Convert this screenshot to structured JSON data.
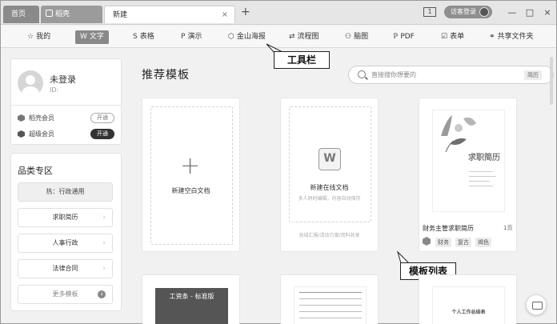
{
  "titlebar": {
    "tabs": [
      {
        "label": "首页"
      },
      {
        "label": "稻壳"
      },
      {
        "label": "新建"
      }
    ],
    "new_tab_symbol": "+",
    "close_symbol": "×",
    "badge_number": "1",
    "login_label": "访客登录",
    "win_min": "—",
    "win_max": "□",
    "win_close": "×"
  },
  "toolbar": {
    "items": [
      {
        "label": "我的",
        "icon": "star-icon",
        "glyph": "☆"
      },
      {
        "label": "文字",
        "icon": "w-icon",
        "glyph": "W"
      },
      {
        "label": "表格",
        "icon": "s-icon",
        "glyph": "S"
      },
      {
        "label": "演示",
        "icon": "p-icon",
        "glyph": "P"
      },
      {
        "label": "金山海报",
        "icon": "poster-icon",
        "glyph": "⬡"
      },
      {
        "label": "流程图",
        "icon": "flowchart-icon",
        "glyph": "⇄"
      },
      {
        "label": "脑图",
        "icon": "mindmap-icon",
        "glyph": "⚇"
      },
      {
        "label": "PDF",
        "icon": "pdf-icon",
        "glyph": "ℙ"
      },
      {
        "label": "表单",
        "icon": "form-icon",
        "glyph": "☑"
      },
      {
        "label": "共享文件夹",
        "icon": "shared-folder-icon",
        "glyph": "⚭"
      }
    ]
  },
  "callouts": {
    "toolbar": "工具栏",
    "template_list": "模板列表"
  },
  "user": {
    "name": "未登录",
    "id": "ID:",
    "memberships": [
      {
        "label": "稻壳会员",
        "action": "开通"
      },
      {
        "label": "超级会员",
        "action": "开通"
      }
    ]
  },
  "categories": {
    "title": "品类专区",
    "items": [
      {
        "label": "热：行政通用"
      },
      {
        "label": "求职简历"
      },
      {
        "label": "人事行政"
      },
      {
        "label": "法律合同"
      },
      {
        "label": "更多模板"
      }
    ]
  },
  "main": {
    "title": "推荐模板",
    "search": {
      "placeholder": "直接搜你想要的",
      "tag": "简历"
    },
    "blank_doc": {
      "label": "新建空白文档"
    },
    "online_doc": {
      "label": "新建在线文档",
      "sub": "多人同时编辑，内容自动保存",
      "footer": "总结汇报/活动方案/资料共享"
    },
    "resume": {
      "thumb_title": "求职简历",
      "name": "财务主管求职简历",
      "pages": "1页",
      "chips": [
        "财务",
        "复古",
        "褐色"
      ]
    },
    "bottom_tile_heading": "工资条 - 标准版",
    "bottom_tile3_heading": "个人工作总结表"
  },
  "colors": {
    "active_tab": "#888888",
    "dark_button": "#333333"
  }
}
